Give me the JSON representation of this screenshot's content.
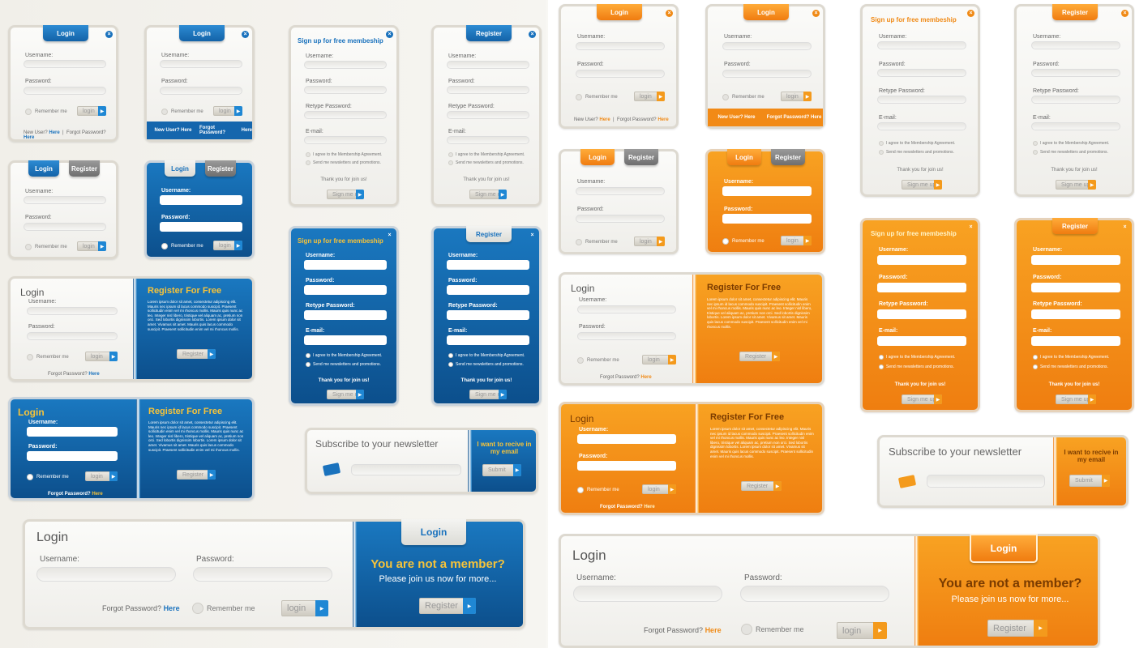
{
  "login": {
    "tab": "Login",
    "username": "Username:",
    "password": "Password:",
    "remember": "Remember me",
    "button": "login",
    "new_user": "New User?",
    "here": "Here",
    "forgot": "Forgot Password?"
  },
  "register": {
    "tab": "Register",
    "title": "Register For Free",
    "button": "Register",
    "body": "Lorem ipsum dolor sit amet, consectetur adipiscing elit. Mauris nec ipsum id lacus commodo suscipit. Praesent sollicitudin enim vel mi rhoncus mollis. Mauris quis nunc ac leo. Integer nisl libero, tristique vel aliquam ac, pretium non orci. Sed lobortis dignissim lobortis. Lorem ipsum dolor sit amet. Vivamus sit amet. Mauris quis lacus commodo suscipit. Praesent sollicitudin enim vel mi rhoncus mollis."
  },
  "signup": {
    "title": "Sign up for free membeship",
    "username": "Username:",
    "password": "Password:",
    "retype": "Retype Password:",
    "email": "E-mail:",
    "agree": "I agree to the Membership Agreement.",
    "newsletter": "Send me newsletters and promotions.",
    "thanks": "Thank you for join us!",
    "button": "Sign me up!"
  },
  "newsletter": {
    "title": "Subscribe to your newsletter",
    "side": "I want to recive in my email",
    "button": "Submit"
  },
  "wide": {
    "title": "Login",
    "username": "Username:",
    "password": "Password:",
    "forgot": "Forgot Password?",
    "here": "Here",
    "remember": "Remember me",
    "login_btn": "login",
    "tab": "Login",
    "member_title": "You are not a member?",
    "member_sub": "Please join us now for more...",
    "register_btn": "Register"
  },
  "colors": {
    "blue": "#1a72bd",
    "orange": "#f08a16",
    "yellow": "#f6c33a"
  },
  "icons": {
    "close": "close-icon",
    "arrow": "arrow-right-icon",
    "mail": "envelope-icon"
  }
}
